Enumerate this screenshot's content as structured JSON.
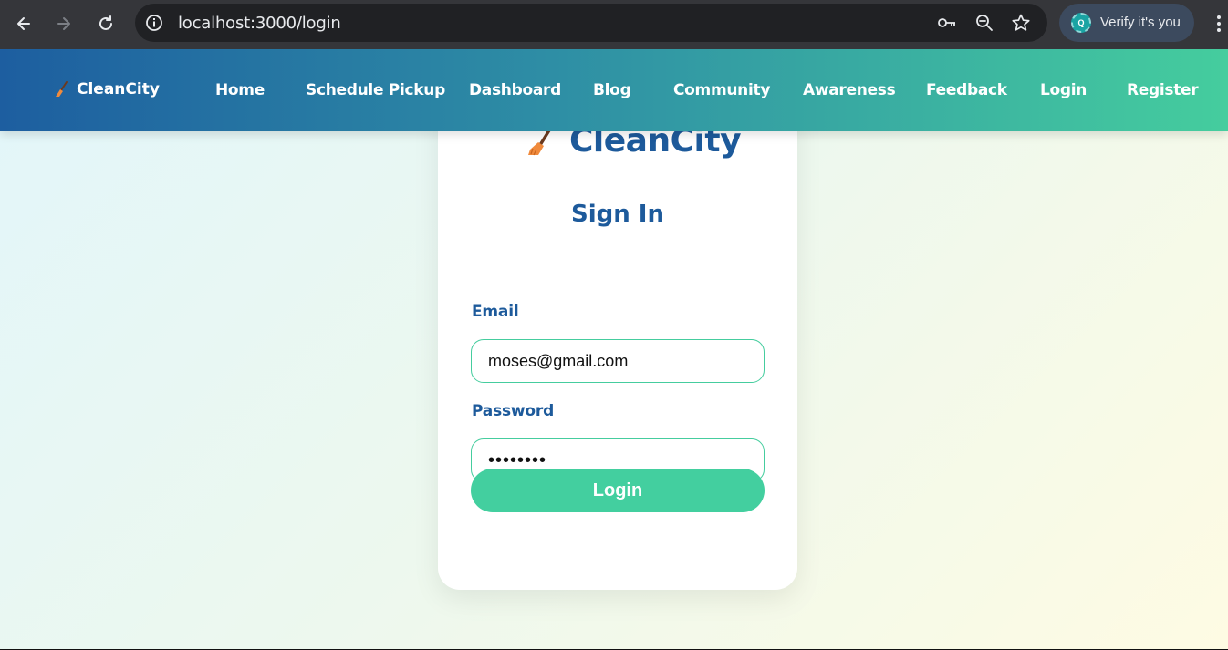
{
  "browser": {
    "url": "localhost:3000/login",
    "profile_chip_label": "Verify it's you",
    "profile_chip_avatar_letter": "Q",
    "icons": [
      "back-icon",
      "forward-icon",
      "reload-icon",
      "site-info-icon",
      "key-icon",
      "zoom-icon",
      "star-icon",
      "more-icon"
    ]
  },
  "navbar": {
    "brand": "CleanCity",
    "links": [
      "Home",
      "Schedule Pickup",
      "Dashboard",
      "Blog",
      "Community",
      "Awareness",
      "Feedback",
      "Login",
      "Register"
    ]
  },
  "login_card": {
    "logo_text": "CleanCity",
    "heading": "Sign In",
    "email_label": "Email",
    "email_value": "moses@gmail.com",
    "password_label": "Password",
    "password_value": "••••••••",
    "submit_label": "Login"
  },
  "colors": {
    "brand_blue": "#1d5a9b",
    "accent_green": "#43cf9f",
    "broom_orange": "#f08a3c"
  }
}
